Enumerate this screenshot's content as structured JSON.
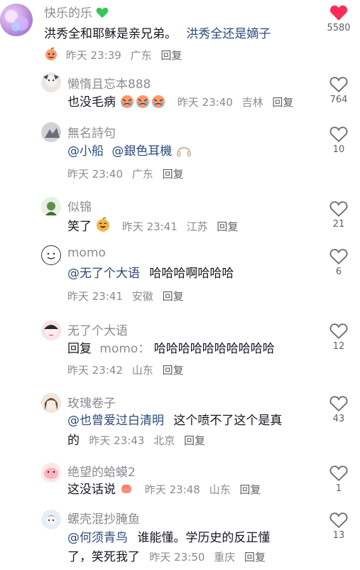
{
  "comment": {
    "author": "快乐的乐",
    "text_a": "洪秀全和耶稣是亲兄弟。",
    "text_b": "洪秀全还是嫡子",
    "date": "昨天 23:39",
    "location": "广东",
    "reply_label": "回复",
    "likes": "5580",
    "liked": true,
    "icons": [
      "green-heart-icon",
      "peach-emoji-icon",
      "heart-filled-icon"
    ]
  },
  "replies": [
    {
      "author": "懒惰且忘本888",
      "text": "也没毛病",
      "date": "昨天 23:40",
      "location": "吉林",
      "reply_label": "回复",
      "likes": "764",
      "emoji": "crying-emoji-icon"
    },
    {
      "author": "無名詩句",
      "mention1": "@小船",
      "mention2": "@銀色耳機",
      "date": "昨天 23:40",
      "location": "广东",
      "reply_label": "回复",
      "likes": "10",
      "emoji": "headphones-icon"
    },
    {
      "author": "似锦",
      "text": "笑了",
      "date": "昨天 23:41",
      "location": "江苏",
      "reply_label": "回复",
      "likes": "21",
      "emoji": "laugh-emoji-icon"
    },
    {
      "author": "momo",
      "mention": "@无了个大语",
      "text": "哈哈哈啊哈哈哈",
      "date": "昨天 23:41",
      "location": "安徽",
      "reply_label": "回复",
      "likes": "6"
    },
    {
      "author": "无了个大语",
      "prefix": "回复",
      "reply_to": "momo：",
      "text": "哈哈哈哈哈哈哈哈哈哈",
      "date": "昨天 23:42",
      "location": "山东",
      "reply_label": "回复",
      "likes": "12"
    },
    {
      "author": "玫瑰卷子",
      "mention": "@也曾爱过白清明",
      "text_a": "这个喷不了这个是真",
      "text_b": "的",
      "date": "昨天 23:43",
      "location": "北京",
      "reply_label": "回复",
      "likes": "43"
    },
    {
      "author": "绝望的蛤蟆2",
      "text": "这没话说",
      "date": "昨天 23:48",
      "location": "山东",
      "reply_label": "回复",
      "likes": "1",
      "emoji": "fist-emoji-icon"
    },
    {
      "author": "螺壳混抄腌鱼",
      "mention": "@何须青鸟",
      "text_a": "谁能懂。学历史的反正懂",
      "text_b": "了，笑死我了",
      "date": "昨天 23:50",
      "location": "重庆",
      "reply_label": "回复",
      "likes": "13"
    }
  ],
  "colors": {
    "like_red": "#fe2c55",
    "meta_gray": "#8a8b91",
    "mention_blue": "#2b4a7c"
  }
}
